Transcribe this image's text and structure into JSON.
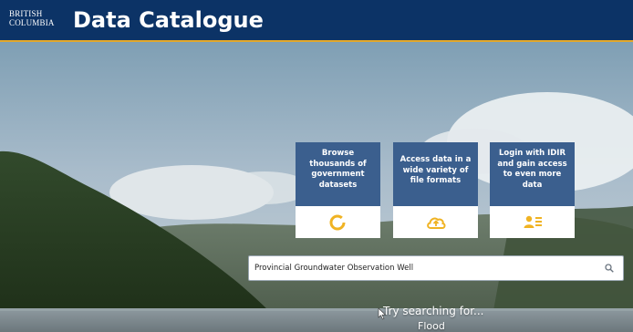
{
  "header": {
    "logo_line1": "BRITISH",
    "logo_line2": "COLUMBIA",
    "title": "Data Catalogue"
  },
  "cards": [
    {
      "text": "Browse thousands of government datasets",
      "icon": "ring-icon"
    },
    {
      "text": "Access data in a wide variety of file formats",
      "icon": "cloud-upload-icon"
    },
    {
      "text": "Login with IDIR and gain access to even more data",
      "icon": "user-list-icon"
    }
  ],
  "search": {
    "value": "Provincial Groundwater Observation Well"
  },
  "suggestions": {
    "heading": "Try searching for...",
    "first": "Flood"
  },
  "colors": {
    "header_bg": "#0c3366",
    "header_accent": "#e3a82b",
    "card_bg": "#3b5f8e",
    "icon_color": "#f0b323"
  }
}
